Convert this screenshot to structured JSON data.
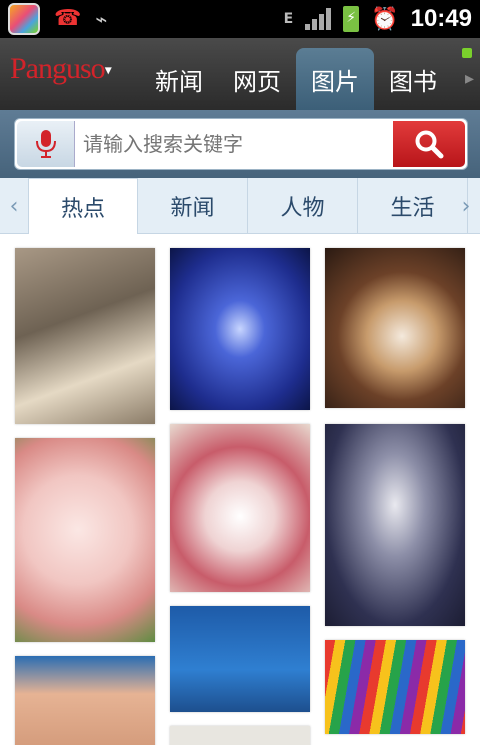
{
  "status": {
    "time": "10:49",
    "network": "E"
  },
  "topnav": {
    "logo": "Panguso",
    "tabs": [
      "新闻",
      "网页",
      "图片",
      "图书"
    ],
    "active_tab": "图片"
  },
  "search": {
    "placeholder": "请输入搜索关键字"
  },
  "categories": {
    "items": [
      "热点",
      "新闻",
      "人物",
      "生活"
    ],
    "active": "热点"
  },
  "colors": {
    "accent_red": "#d3232a",
    "nav_dark": "#2b2b2b",
    "tab_active": "#4b6e88"
  }
}
